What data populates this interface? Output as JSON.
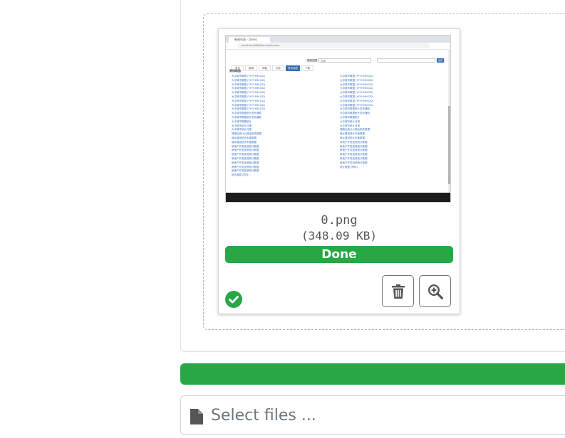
{
  "preview": {
    "file_name": "0.png",
    "file_size": "(348.09 KB)",
    "status_label": "Done",
    "delete_icon": "trash-icon",
    "zoom_icon": "zoom-in-icon",
    "success_icon": "check-circle-icon",
    "thumbnail": {
      "tab_title": "新闻列表 - Demo",
      "url": "localhost:8080/demo/list/news",
      "nav_items": [
        "首页",
        "新闻",
        "博客",
        "问答",
        "资讯动态",
        "下载"
      ],
      "active_nav": "资讯动态",
      "search_label": "搜索范围",
      "search_scope": "全部",
      "search_button": "搜索",
      "heading": "资讯动态",
      "left_items": [
        "大中城市数据 (YYYY-MM-DD)",
        "大中城市数据 (YYYY-MM-DD)",
        "大中城市数据 (YYYY-MM-DD)",
        "大中城市数据 (YYYY-MM-DD)",
        "大中城市数据 (YYYY-MM-DD)",
        "大中城市数据 (YYYY-MM-DD)",
        "大中城市数据 (YYYY-MM-DD)",
        "大中城市数据 (YYYY-MM-DD)",
        "大中城市数据 (YYYY-MM-DD)",
        "大中城市数据统计发布通知",
        "大中城市数据统计发布通知",
        "大中城市数据统计",
        "大中城市统计月报",
        "大中城市统计月报",
        "城镇化统计公报及相关数据",
        "城乡建设统计年鉴数据",
        "城乡建设统计年鉴数据",
        "房地产开发投资统计数据",
        "房地产开发投资统计数据",
        "房地产开发投资统计数据",
        "房地产开发投资统计数据",
        "房地产开发投资统计数据",
        "房地产开发投资统计数据",
        "房地产开发投资统计数据",
        "统计数据 (附件)"
      ],
      "right_items": [
        "大中城市数据 (YYYY-MM-DD)",
        "大中城市数据 (YYYY-MM-DD)",
        "大中城市数据 (YYYY-MM-DD)",
        "大中城市数据 (YYYY-MM-DD)",
        "大中城市数据 (YYYY-MM-DD)",
        "大中城市数据 (YYYY-MM-DD)",
        "大中城市数据 (YYYY-MM-DD)",
        "大中城市数据 (YYYY-MM-DD)",
        "大中城市数据统计发布通知",
        "大中城市数据统计发布通知",
        "大中城市数据统计",
        "大中城市统计月报",
        "大中城市统计月报",
        "城镇化统计公报及相关数据",
        "城乡建设统计年鉴数据",
        "城乡建设统计年鉴数据",
        "房地产开发投资统计数据",
        "房地产开发投资统计数据",
        "房地产开发投资统计数据",
        "房地产开发投资统计数据",
        "房地产开发投资统计数据",
        "房地产开发投资统计数据",
        "统计数据 (附件)"
      ]
    }
  },
  "upload": {
    "overall_progress_percent": 100,
    "file_icon": "file-icon",
    "select_files_label": "Select files ..."
  },
  "colors": {
    "success": "#28a745",
    "border": "#dee2e6",
    "muted_text": "#6c757d"
  }
}
